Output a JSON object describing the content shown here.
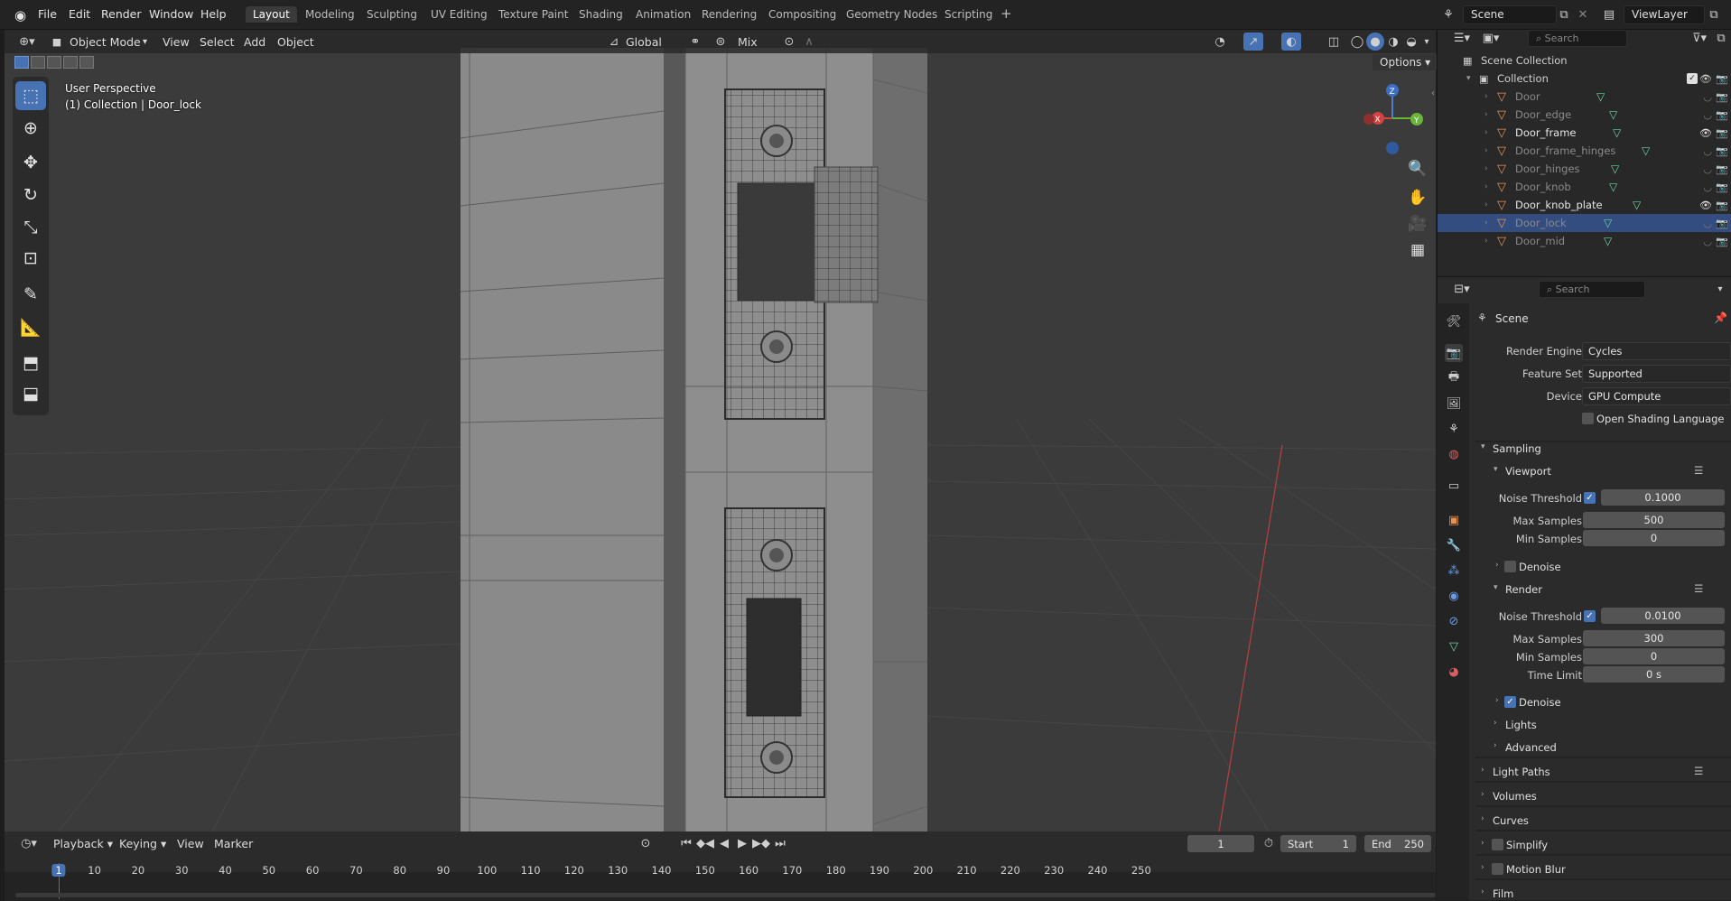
{
  "topbar": {
    "menus": [
      "File",
      "Edit",
      "Render",
      "Window",
      "Help"
    ],
    "workspaces": [
      "Layout",
      "Modeling",
      "Sculpting",
      "UV Editing",
      "Texture Paint",
      "Shading",
      "Animation",
      "Rendering",
      "Compositing",
      "Geometry Nodes",
      "Scripting"
    ],
    "active_workspace": "Layout",
    "scene_name": "Scene",
    "viewlayer_name": "ViewLayer"
  },
  "viewport_header": {
    "mode": "Object Mode",
    "menus": [
      "View",
      "Select",
      "Add",
      "Object"
    ],
    "orientation": "Global",
    "pivot": "Mix",
    "options_label": "Options"
  },
  "viewport_overlay": {
    "perspective": "User Perspective",
    "collection_info": "(1) Collection | Door_lock"
  },
  "gizmo": {
    "x": "X",
    "y": "Y",
    "z": "Z"
  },
  "outliner": {
    "search_placeholder": "Search",
    "root": "Scene Collection",
    "collection": "Collection",
    "items": [
      {
        "name": "Door",
        "visible": false,
        "selected": false
      },
      {
        "name": "Door_edge",
        "visible": false,
        "selected": false
      },
      {
        "name": "Door_frame",
        "visible": true,
        "selected": false
      },
      {
        "name": "Door_frame_hinges",
        "visible": false,
        "selected": false
      },
      {
        "name": "Door_hinges",
        "visible": false,
        "selected": false
      },
      {
        "name": "Door_knob",
        "visible": false,
        "selected": false
      },
      {
        "name": "Door_knob_plate",
        "visible": true,
        "selected": false
      },
      {
        "name": "Door_lock",
        "visible": false,
        "selected": true
      },
      {
        "name": "Door_mid",
        "visible": false,
        "selected": false
      }
    ]
  },
  "properties": {
    "search_placeholder": "Search",
    "context": "Scene",
    "render_engine_label": "Render Engine",
    "render_engine": "Cycles",
    "feature_set_label": "Feature Set",
    "feature_set": "Supported",
    "device_label": "Device",
    "device": "GPU Compute",
    "osl_label": "Open Shading Language",
    "sampling": "Sampling",
    "viewport": "Viewport",
    "noise_threshold_label": "Noise Threshold",
    "vp_noise_threshold": "0.1000",
    "max_samples_label": "Max Samples",
    "vp_max_samples": "500",
    "min_samples_label": "Min Samples",
    "vp_min_samples": "0",
    "denoise_label": "Denoise",
    "render": "Render",
    "r_noise_threshold": "0.0100",
    "r_max_samples": "300",
    "r_min_samples": "0",
    "time_limit_label": "Time Limit",
    "r_time_limit": "0 s",
    "lights": "Lights",
    "advanced": "Advanced",
    "light_paths": "Light Paths",
    "volumes": "Volumes",
    "curves": "Curves",
    "simplify": "Simplify",
    "motion_blur": "Motion Blur",
    "film": "Film"
  },
  "timeline": {
    "menus": [
      "Playback",
      "Keying",
      "View",
      "Marker"
    ],
    "current_frame": "1",
    "start_label": "Start",
    "start": "1",
    "end_label": "End",
    "end": "250",
    "ticks": [
      "1",
      "10",
      "20",
      "30",
      "40",
      "50",
      "60",
      "70",
      "80",
      "90",
      "100",
      "110",
      "120",
      "130",
      "140",
      "150",
      "160",
      "170",
      "180",
      "190",
      "200",
      "210",
      "220",
      "230",
      "240",
      "250"
    ]
  },
  "colors": {
    "accent": "#4772b3",
    "selected_row": "#334d80",
    "mesh_icon": "#e8924e",
    "data_icon": "#6ed1a3"
  }
}
